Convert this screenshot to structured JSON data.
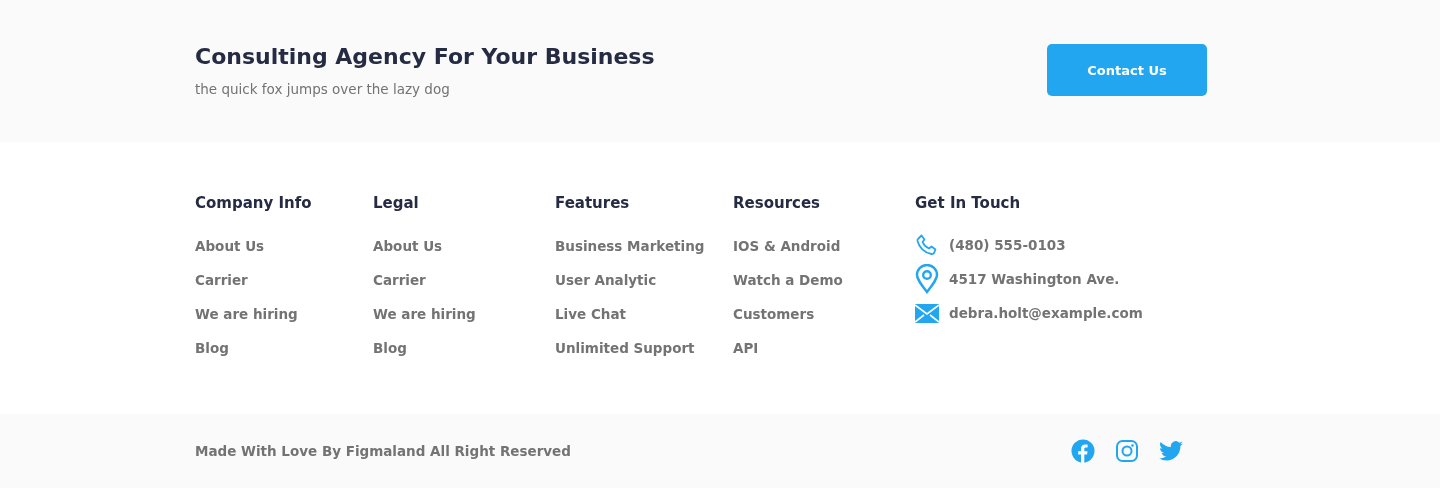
{
  "header": {
    "title": "Consulting Agency For Your Business",
    "subtitle": "the quick fox jumps over the lazy dog",
    "button": "Contact Us"
  },
  "columns": [
    {
      "heading": "Company Info",
      "links": [
        "About Us",
        "Carrier",
        "We are hiring",
        "Blog"
      ]
    },
    {
      "heading": "Legal",
      "links": [
        "About Us",
        "Carrier",
        "We are hiring",
        "Blog"
      ]
    },
    {
      "heading": "Features",
      "links": [
        "Business Marketing",
        "User Analytic",
        "Live Chat",
        "Unlimited Support"
      ]
    },
    {
      "heading": "Resources",
      "links": [
        "IOS & Android",
        "Watch a Demo",
        "Customers",
        "API"
      ]
    }
  ],
  "contact": {
    "heading": "Get In Touch",
    "items": [
      {
        "kind": "phone",
        "text": "(480) 555-0103"
      },
      {
        "kind": "location",
        "text": "4517 Washington Ave."
      },
      {
        "kind": "email",
        "text": "debra.holt@example.com"
      }
    ]
  },
  "bottom": {
    "copyright": "Made With Love By Figmaland All Right Reserved",
    "social": [
      {
        "kind": "facebook"
      },
      {
        "kind": "instagram"
      },
      {
        "kind": "twitter"
      }
    ]
  }
}
